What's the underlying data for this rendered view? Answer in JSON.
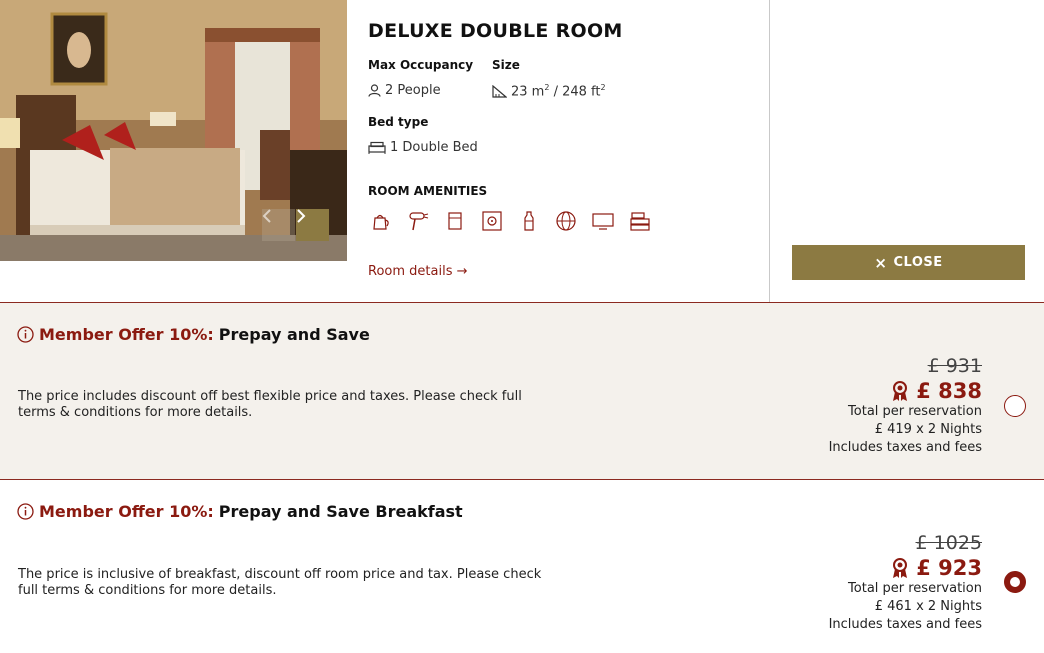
{
  "room": {
    "title": "DELUXE DOUBLE ROOM",
    "occupancy_label": "Max Occupancy",
    "occupancy_value": "2 People",
    "size_label": "Size",
    "size_m": "23 m",
    "size_sep": " / 248 ft",
    "size_exp": "2",
    "bed_label": "Bed type",
    "bed_value": "1 Double Bed",
    "amenities_label": "ROOM AMENITIES",
    "amenity_icons": [
      "kettle-icon",
      "hairdryer-icon",
      "minibar-icon",
      "safe-icon",
      "water-bottle-icon",
      "internet-icon",
      "tv-icon",
      "linen-icon"
    ],
    "details_link": "Room details →"
  },
  "close_button": {
    "icon": "×",
    "label": "CLOSE"
  },
  "offers": [
    {
      "member_label": "Member Offer 10%:",
      "plan_name": "Prepay and Save",
      "description": "The price includes discount off best flexible price and taxes. Please check full terms & conditions for more details.",
      "old_price": "£ 931",
      "new_price": "£ 838",
      "total_label": "Total per reservation",
      "nightly": "£ 419 x 2 Nights",
      "taxes_note": "Includes taxes and fees",
      "selected": false
    },
    {
      "member_label": "Member Offer 10%:",
      "plan_name": "Prepay and Save Breakfast",
      "description": "The price is inclusive of breakfast, discount off room price and tax. Please check full terms & conditions for more details.",
      "old_price": "£ 1025",
      "new_price": "£ 923",
      "total_label": "Total per reservation",
      "nightly": "£ 461 x 2 Nights",
      "taxes_note": "Includes taxes and fees",
      "selected": true
    }
  ],
  "colors": {
    "accent": "#8b1a10",
    "gold": "#8c7a42",
    "offer_bg": "#f4f1ec"
  }
}
